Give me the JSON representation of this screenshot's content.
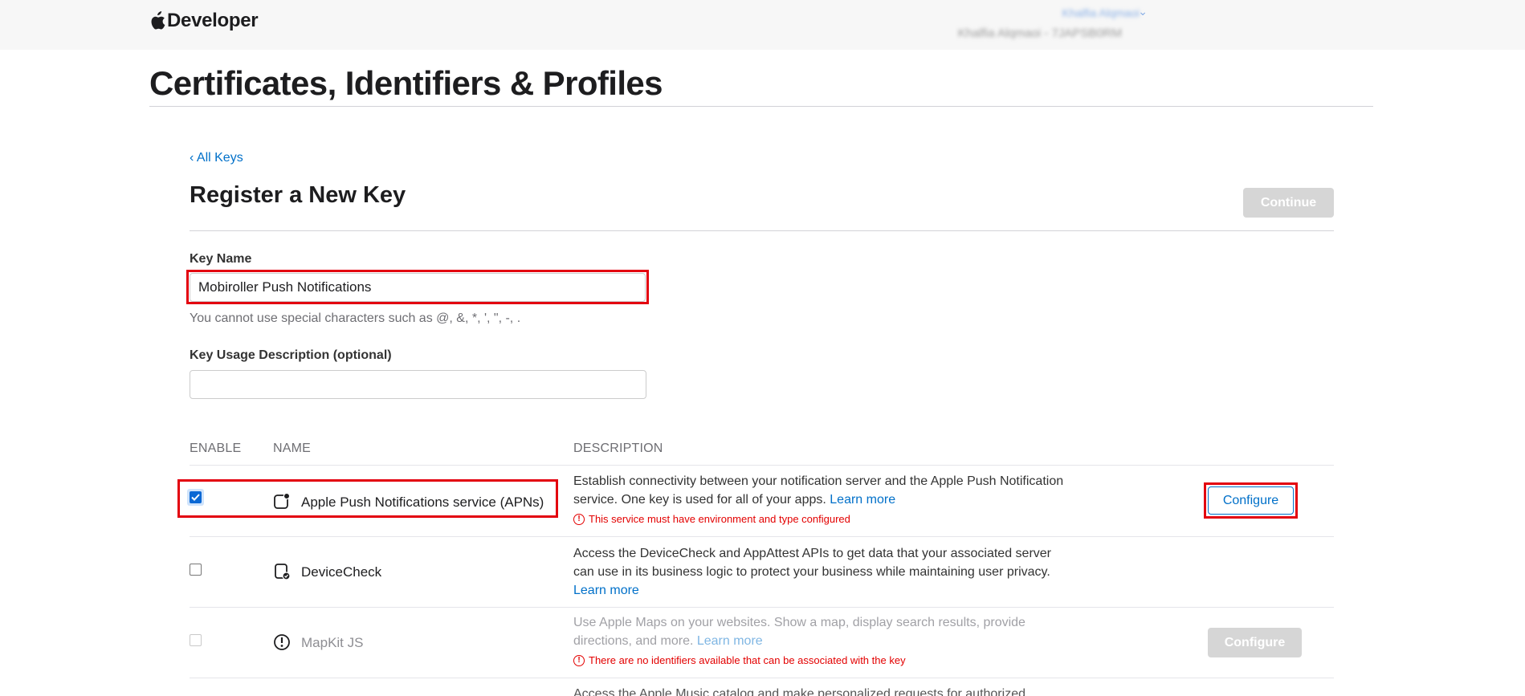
{
  "header": {
    "brand_text": "Developer",
    "account_name": "Khalfia Alqmaoi",
    "account_team": "Khalfia Alqmaoi - 7JAPSB0RM"
  },
  "page": {
    "title": "Certificates, Identifiers & Profiles"
  },
  "form": {
    "back_link": "‹ All Keys",
    "section_title": "Register a New Key",
    "continue_label": "Continue",
    "key_name_label": "Key Name",
    "key_name_value": "Mobiroller Push Notifications",
    "key_name_hint": "You cannot use special characters such as @, &, *, ', \", -, .",
    "key_usage_label": "Key Usage Description (optional)",
    "key_usage_value": ""
  },
  "table": {
    "headers": {
      "enable": "ENABLE",
      "name": "NAME",
      "description": "DESCRIPTION"
    },
    "rows": [
      {
        "name": "Apple Push Notifications service (APNs)",
        "icon": "push-notification-icon",
        "enabled": true,
        "description": "Establish connectivity between your notification server and the Apple Push Notification service. One key is used for all of your apps.",
        "link": "Learn more",
        "warning": "This service must have environment and type configured",
        "action": "Configure"
      },
      {
        "name": "DeviceCheck",
        "icon": "device-check-icon",
        "enabled": false,
        "description": "Access the DeviceCheck and AppAttest APIs to get data that your associated server can use in its business logic to protect your business while maintaining user privacy.",
        "link": "Learn more"
      },
      {
        "name": "MapKit JS",
        "icon": "mapkit-icon",
        "enabled": false,
        "disabled": true,
        "description": "Use Apple Maps on your websites. Show a map, display search results, provide directions, and more.",
        "link": "Learn more",
        "warning": "There are no identifiers available that can be associated with the key",
        "action": "Configure"
      },
      {
        "description": "Access the Apple Music catalog and make personalized requests for authorized"
      }
    ]
  },
  "colors": {
    "accent": "#0070c9",
    "highlight": "#e3000f",
    "warning": "#e30000",
    "checkbox": "#0b68d4"
  }
}
